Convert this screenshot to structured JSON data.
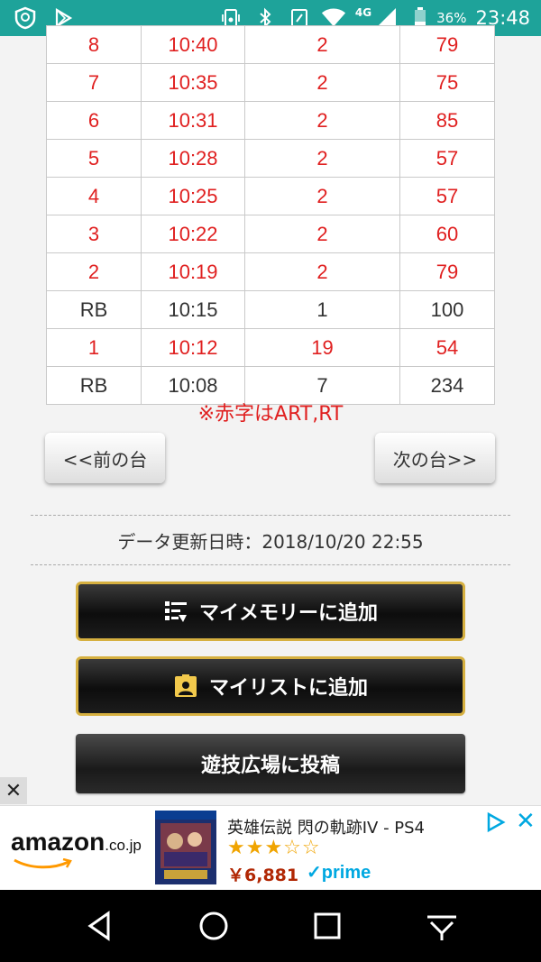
{
  "status_bar": {
    "network": "4G",
    "battery": "36%",
    "time": "23:48",
    "icons": [
      "shield-icon",
      "play-store-icon",
      "vibrate-icon",
      "bluetooth-icon",
      "nfc-icon",
      "wifi-icon",
      "signal-icon",
      "battery-icon"
    ]
  },
  "table": {
    "rows": [
      {
        "no": "8",
        "time": "10:40",
        "count": "2",
        "games": "79",
        "art": true
      },
      {
        "no": "7",
        "time": "10:35",
        "count": "2",
        "games": "75",
        "art": true
      },
      {
        "no": "6",
        "time": "10:31",
        "count": "2",
        "games": "85",
        "art": true
      },
      {
        "no": "5",
        "time": "10:28",
        "count": "2",
        "games": "57",
        "art": true
      },
      {
        "no": "4",
        "time": "10:25",
        "count": "2",
        "games": "57",
        "art": true
      },
      {
        "no": "3",
        "time": "10:22",
        "count": "2",
        "games": "60",
        "art": true
      },
      {
        "no": "2",
        "time": "10:19",
        "count": "2",
        "games": "79",
        "art": true
      },
      {
        "no": "RB",
        "time": "10:15",
        "count": "1",
        "games": "100",
        "art": false
      },
      {
        "no": "1",
        "time": "10:12",
        "count": "19",
        "games": "54",
        "art": true
      },
      {
        "no": "RB",
        "time": "10:08",
        "count": "7",
        "games": "234",
        "art": false
      }
    ]
  },
  "note": "※赤字はART,RT",
  "nav": {
    "prev": "<<前の台",
    "next": "次の台>>"
  },
  "update_text": "データ更新日時：2018/10/20 22:55",
  "buttons": {
    "memory": "マイメモリーに追加",
    "list": "マイリストに追加",
    "post": "遊技広場に投稿"
  },
  "ad": {
    "close": "✕",
    "brand": "amazon",
    "brand_tld": ".co.jp",
    "title": "英雄伝説 閃の軌跡IV - PS4",
    "rating": 3,
    "rating_max": 5,
    "price": "￥6,881",
    "prime": "prime"
  },
  "colors": {
    "status_bar": "#1ea39a",
    "art_red": "#e02020",
    "gold_border": "#d6b040",
    "prime_blue": "#00a8e1"
  }
}
